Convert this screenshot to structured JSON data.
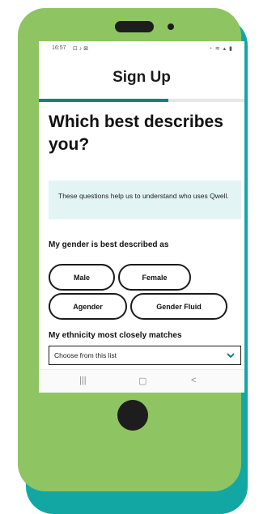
{
  "status_bar": {
    "time": "16:57",
    "left_icons": "⊡ ♪ ⊠",
    "right_icons": "◔ ≋ ▴ ▮"
  },
  "header": {
    "title": "Sign Up"
  },
  "progress": {
    "fraction": 0.63,
    "accent_color": "#17807d"
  },
  "main": {
    "heading": "Which best describes you?",
    "info_text": "These questions help us to understand who uses Qwell.",
    "gender_label": "My gender is best described as",
    "gender_options": [
      "Male",
      "Female",
      "Agender",
      "Gender Fluid"
    ],
    "ethnicity_label": "My ethnicity most closely matches",
    "ethnicity_select": {
      "value": "Choose from this list"
    }
  },
  "nav_bar": {
    "recent_icon": "|||",
    "home_icon": "▢",
    "back_icon": "<"
  },
  "colors": {
    "device_body": "#8fc462",
    "device_shadow": "#13a7a3",
    "info_bg": "#e3f4f4"
  }
}
